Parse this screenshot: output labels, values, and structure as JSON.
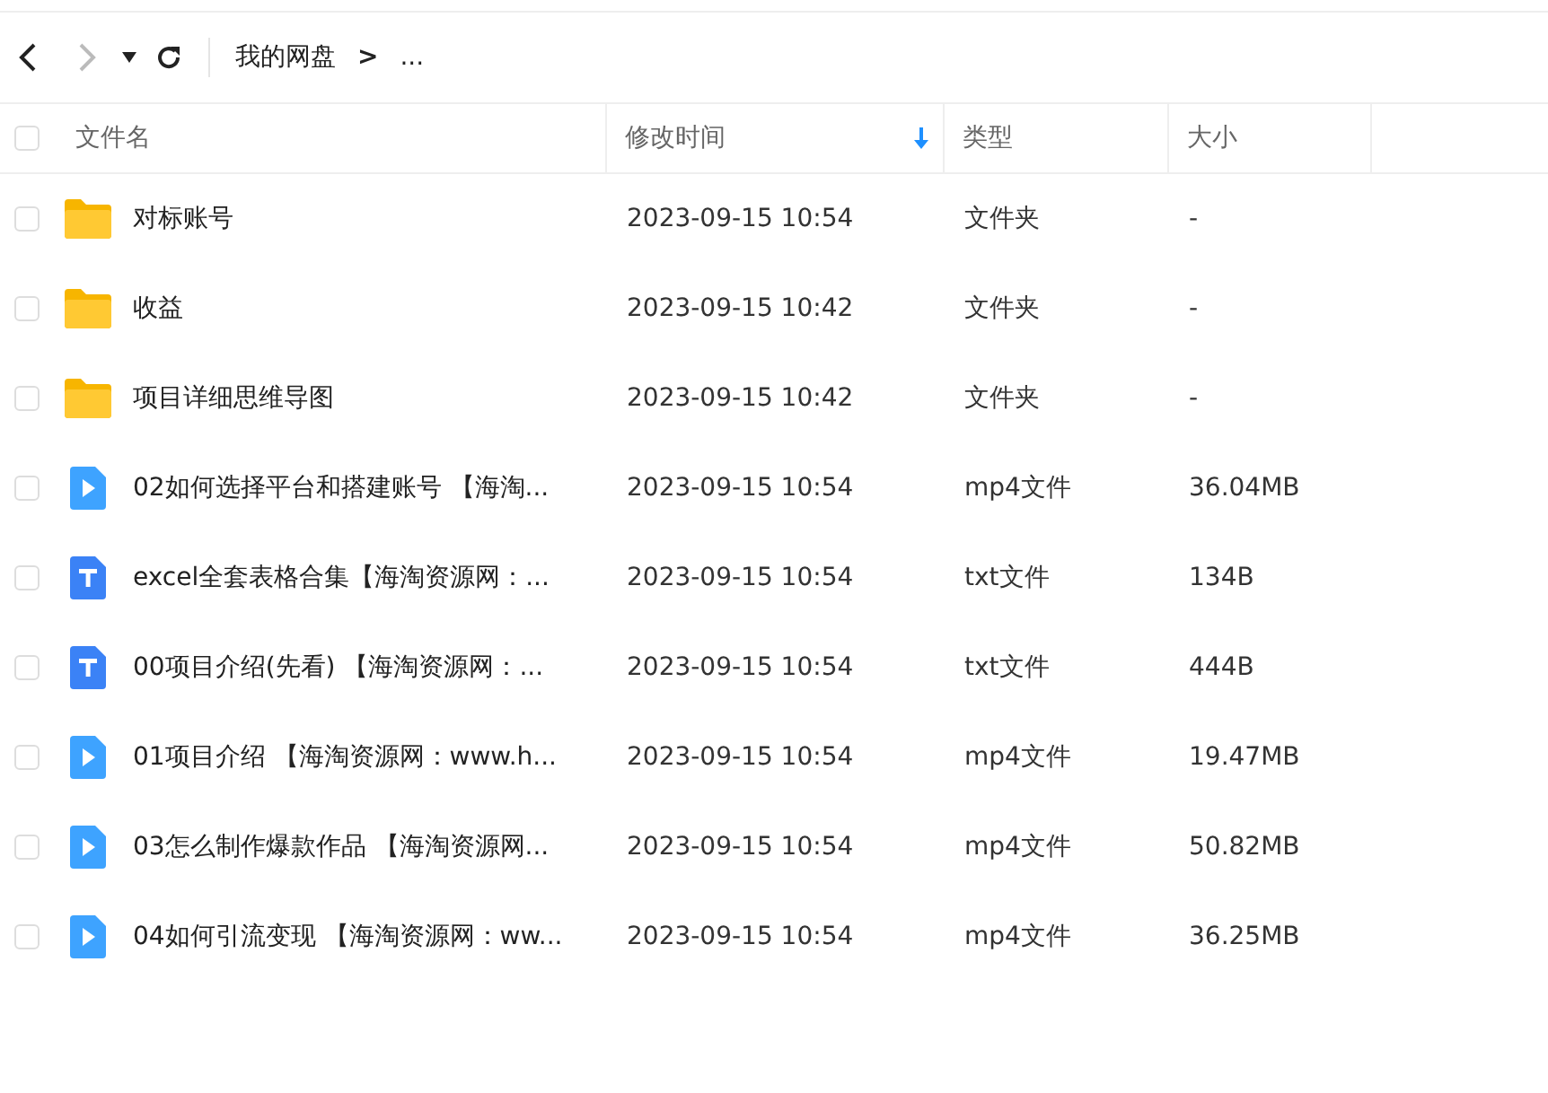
{
  "toolbar": {
    "back_disabled": false,
    "forward_disabled": true,
    "breadcrumb": [
      {
        "label": "我的网盘"
      },
      {
        "label": "..."
      }
    ],
    "separator": ">"
  },
  "table": {
    "header_checkbox": {
      "checked": false
    },
    "columns": [
      {
        "label": "文件名",
        "sorted": false
      },
      {
        "label": "修改时间",
        "sorted": true
      },
      {
        "label": "类型",
        "sorted": false
      },
      {
        "label": "大小",
        "sorted": false
      }
    ],
    "rows": [
      {
        "kind": "folder",
        "name": "对标账号",
        "modified": "2023-09-15 10:54",
        "type": "文件夹",
        "size": "-",
        "checked": false
      },
      {
        "kind": "folder",
        "name": "收益",
        "modified": "2023-09-15 10:42",
        "type": "文件夹",
        "size": "-",
        "checked": false
      },
      {
        "kind": "folder",
        "name": "项目详细思维导图",
        "modified": "2023-09-15 10:42",
        "type": "文件夹",
        "size": "-",
        "checked": false
      },
      {
        "kind": "video",
        "name": "02如何选择平台和搭建账号 【海淘...",
        "modified": "2023-09-15 10:54",
        "type": "mp4文件",
        "size": "36.04MB",
        "checked": false
      },
      {
        "kind": "text",
        "name": "excel全套表格合集【海淘资源网：...",
        "modified": "2023-09-15 10:54",
        "type": "txt文件",
        "size": "134B",
        "checked": false
      },
      {
        "kind": "text",
        "name": "00项目介绍(先看) 【海淘资源网：...",
        "modified": "2023-09-15 10:54",
        "type": "txt文件",
        "size": "444B",
        "checked": false
      },
      {
        "kind": "video",
        "name": "01项目介绍 【海淘资源网：www.h...",
        "modified": "2023-09-15 10:54",
        "type": "mp4文件",
        "size": "19.47MB",
        "checked": false
      },
      {
        "kind": "video",
        "name": "03怎么制作爆款作品 【海淘资源网...",
        "modified": "2023-09-15 10:54",
        "type": "mp4文件",
        "size": "50.82MB",
        "checked": false
      },
      {
        "kind": "video",
        "name": "04如何引流变现 【海淘资源网：ww...",
        "modified": "2023-09-15 10:54",
        "type": "mp4文件",
        "size": "36.25MB",
        "checked": false
      }
    ]
  }
}
